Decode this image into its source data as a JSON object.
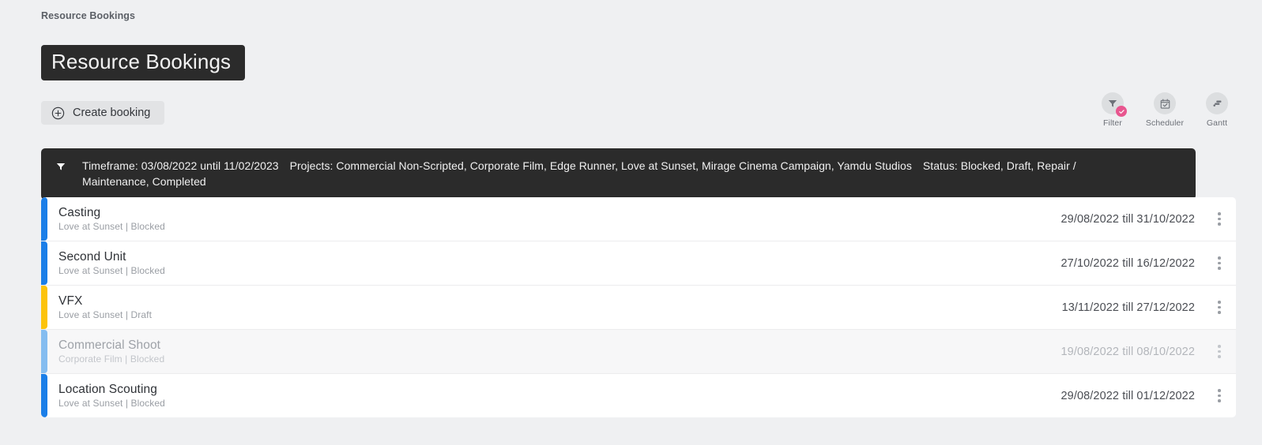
{
  "breadcrumb": "Resource Bookings",
  "page_title": "Resource Bookings",
  "toolbar": {
    "create_label": "Create booking",
    "create_icon": "plus-circle-icon"
  },
  "actions": [
    {
      "label": "Filter",
      "icon": "funnel-icon",
      "badge": "check-badge",
      "badge_color": "#e8568f"
    },
    {
      "label": "Scheduler",
      "icon": "calendar-check-icon",
      "badge": null
    },
    {
      "label": "Gantt",
      "icon": "gantt-bars-icon",
      "badge": null
    }
  ],
  "filter_bar": {
    "icon": "funnel-icon",
    "timeframe": "Timeframe: 03/08/2022 until 11/02/2023",
    "projects": "Projects: Commercial Non-Scripted, Corporate Film, Edge Runner, Love at Sunset, Mirage Cinema Campaign, Yamdu Studios",
    "status": "Status: Blocked, Draft, Repair / Maintenance, Completed"
  },
  "colors": {
    "page_background": "#eff0f2",
    "dark_panel": "#2b2b2b",
    "accent_blue": "#1a7ee8",
    "accent_blue_muted": "#85bdf0",
    "accent_yellow": "#fcc30b",
    "badge_pink": "#e8568f"
  },
  "bookings": [
    {
      "title": "Casting",
      "subtitle": "Love at Sunset | Blocked",
      "project": "Love at Sunset",
      "status": "Blocked",
      "dates": "29/08/2022 till 31/10/2022",
      "start": "29/08/2022",
      "end": "31/10/2022",
      "accent": "#1a7ee8",
      "dimmed": false
    },
    {
      "title": "Second Unit",
      "subtitle": "Love at Sunset | Blocked",
      "project": "Love at Sunset",
      "status": "Blocked",
      "dates": "27/10/2022 till 16/12/2022",
      "start": "27/10/2022",
      "end": "16/12/2022",
      "accent": "#1a7ee8",
      "dimmed": false
    },
    {
      "title": "VFX",
      "subtitle": "Love at Sunset | Draft",
      "project": "Love at Sunset",
      "status": "Draft",
      "dates": "13/11/2022 till 27/12/2022",
      "start": "13/11/2022",
      "end": "27/12/2022",
      "accent": "#fcc30b",
      "dimmed": false
    },
    {
      "title": "Commercial Shoot",
      "subtitle": "Corporate Film | Blocked",
      "project": "Corporate Film",
      "status": "Blocked",
      "dates": "19/08/2022 till 08/10/2022",
      "start": "19/08/2022",
      "end": "08/10/2022",
      "accent": "#85bdf0",
      "dimmed": true
    },
    {
      "title": "Location Scouting",
      "subtitle": "Love at Sunset | Blocked",
      "project": "Love at Sunset",
      "status": "Blocked",
      "dates": "29/08/2022 till 01/12/2022",
      "start": "29/08/2022",
      "end": "01/12/2022",
      "accent": "#1a7ee8",
      "dimmed": false
    }
  ]
}
